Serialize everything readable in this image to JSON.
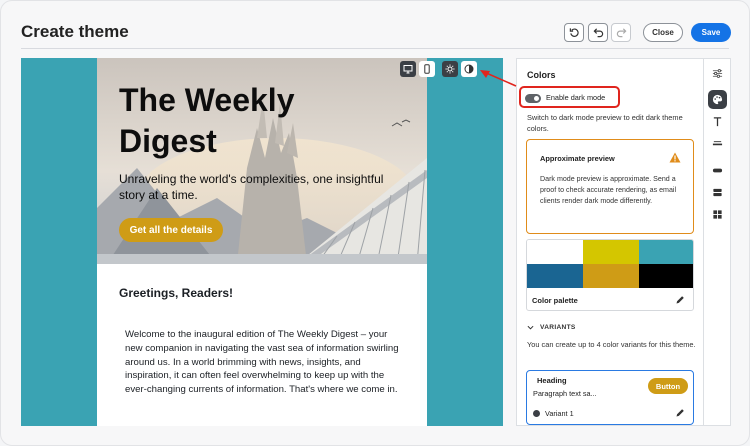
{
  "header": {
    "title": "Create theme",
    "close_label": "Close",
    "save_label": "Save"
  },
  "preview": {
    "hero_title": "The Weekly Digest",
    "hero_subtitle": "Unraveling the world's complexities, one insightful story at a time.",
    "cta_label": "Get all the details",
    "greeting": "Greetings, Readers!",
    "body": "Welcome to the inaugural edition of The Weekly Digest – your new companion in navigating the vast sea of information swirling around us. In a world brimming with news, insights, and inspiration, it can often feel overwhelming to keep up with the ever-changing currents of information. That's where we come in.",
    "canvas_color": "#3aa3b3",
    "cta_color": "#cf9c16",
    "toolbar_icons": [
      "desktop-icon",
      "mobile-icon",
      "sun-icon",
      "contrast-icon"
    ]
  },
  "panel": {
    "section_title": "Colors",
    "dark_mode_label": "Enable dark mode",
    "dark_mode_enabled": true,
    "dark_mode_description": "Switch to dark mode preview to edit dark theme colors.",
    "warning_title": "Approximate preview",
    "warning_text": "Dark mode preview is approximate. Send a proof to check accurate rendering, as email clients render dark mode differently.",
    "palette_label": "Color palette",
    "palette_colors": [
      "#ffffff",
      "#d4c600",
      "#3aa3b3",
      "#1a6592",
      "#cf9c16",
      "#000000"
    ],
    "variants_heading": "VARIANTS",
    "variants_description": "You can create up to 4 color variants for this theme.",
    "variant": {
      "heading": "Heading",
      "paragraph": "Paragraph text sa...",
      "button": "Button",
      "name": "Variant 1"
    }
  },
  "rail": {
    "icons": [
      "sliders-icon",
      "palette-icon",
      "text-icon",
      "divider-icon",
      "button-icon",
      "container-icon",
      "grid-icon"
    ]
  },
  "accent": {
    "save": "#1473e6",
    "highlight": "#e0251e",
    "warning": "#e08c1a"
  }
}
